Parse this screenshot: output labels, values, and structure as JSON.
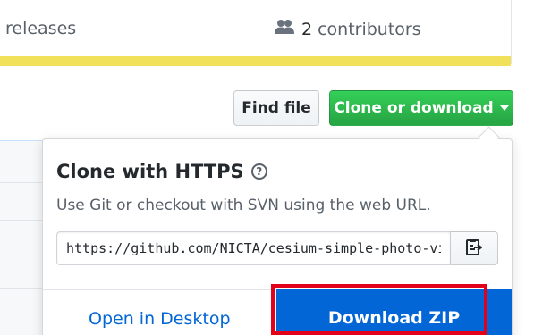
{
  "repo_stats": {
    "releases_label": "releases",
    "contributors_count": "2",
    "contributors_label": "contributors",
    "language_bar_color": "#f1e05a"
  },
  "toolbar": {
    "find_file_label": "Find file",
    "clone_label": "Clone or download"
  },
  "clone_dropdown": {
    "title": "Clone with HTTPS",
    "help_icon": "question-circle-icon",
    "description": "Use Git or checkout with SVN using the web URL.",
    "url": "https://github.com/NICTA/cesium-simple-photo-viewer.git",
    "copy_icon": "clippy-icon",
    "open_desktop_label": "Open in Desktop",
    "download_zip_label": "Download ZIP"
  },
  "colors": {
    "clone_button": "#28a745",
    "download_button": "#0366d6",
    "link": "#0366d6",
    "highlight": "#e3001b"
  }
}
